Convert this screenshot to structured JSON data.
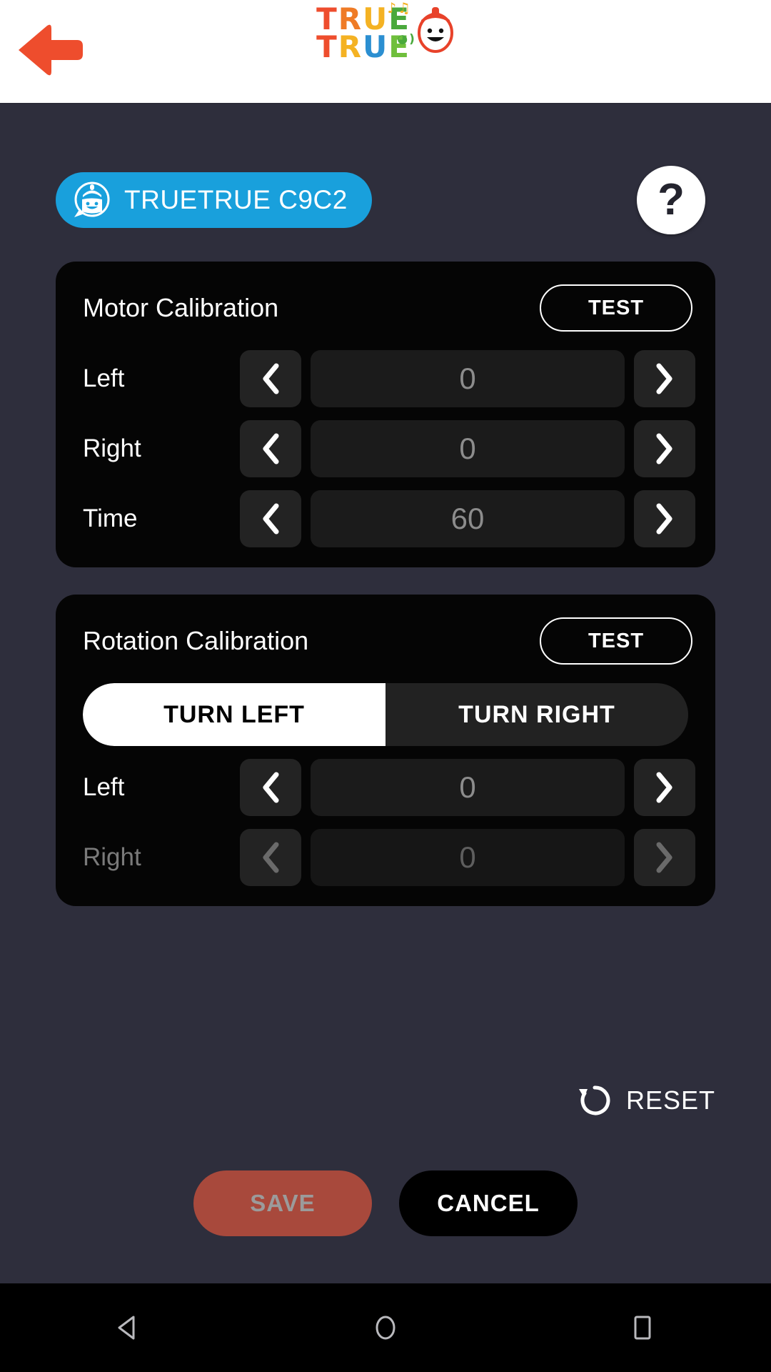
{
  "header": {
    "back_icon": "back-arrow-icon",
    "back_color": "#ee4d2d",
    "logo": {
      "line1": [
        "T",
        "R",
        "U",
        "E"
      ],
      "line2": [
        "T",
        "R",
        "U",
        "E"
      ],
      "alt": "TRUE TRUE"
    }
  },
  "device": {
    "icon": "robot-chat-icon",
    "name": "TRUETRUE C9C2",
    "badge_color": "#19a0dc"
  },
  "help": {
    "label": "?",
    "name": "help-button"
  },
  "motor": {
    "title": "Motor Calibration",
    "test_label": "TEST",
    "rows": [
      {
        "label": "Left",
        "value": "0",
        "disabled": false
      },
      {
        "label": "Right",
        "value": "0",
        "disabled": false
      },
      {
        "label": "Time",
        "value": "60",
        "disabled": false
      }
    ]
  },
  "rotation": {
    "title": "Rotation Calibration",
    "test_label": "TEST",
    "toggle": {
      "left_label": "TURN LEFT",
      "right_label": "TURN RIGHT",
      "selected": "TURN LEFT"
    },
    "rows": [
      {
        "label": "Left",
        "value": "0",
        "disabled": false
      },
      {
        "label": "Right",
        "value": "0",
        "disabled": true
      }
    ]
  },
  "footer": {
    "reset_label": "RESET",
    "reset_icon": "rotate-ccw-icon",
    "save_label": "SAVE",
    "save_enabled": false,
    "save_color": "#a8493c",
    "cancel_label": "CANCEL"
  },
  "navbar": {
    "back": "nav-back-icon",
    "home": "nav-home-icon",
    "recents": "nav-recents-icon"
  },
  "colors": {
    "page_bg": "#2e2e3c",
    "card_bg": "#050505",
    "accent_blue": "#19a0dc",
    "accent_red": "#ee4d2d"
  }
}
